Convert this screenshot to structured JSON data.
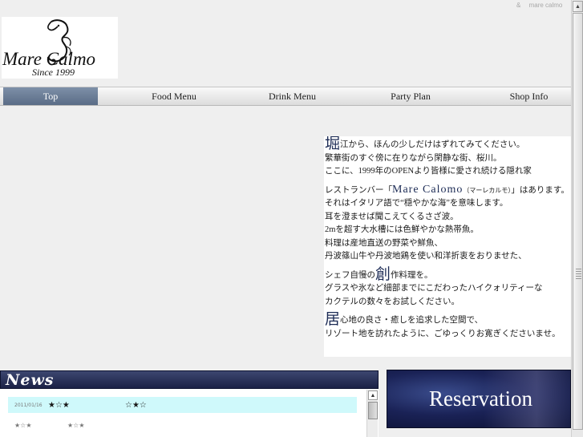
{
  "header": {
    "ampersand": "&",
    "site_name": "mare calmo"
  },
  "logo": {
    "name": "Mare Calmo",
    "since": "Since 1999"
  },
  "nav": {
    "items": [
      {
        "label": "Top"
      },
      {
        "label": "Food Menu"
      },
      {
        "label": "Drink Menu"
      },
      {
        "label": "Party Plan"
      },
      {
        "label": "Shop Info"
      }
    ]
  },
  "intro": {
    "p1_initial": "堀",
    "p1_line1": "江から、ほんの少しだけはずれてみてください。",
    "p1_line2": "繁華街のすぐ傍に在りながら閑静な街、桜川。",
    "p1_line3": "ここに、1999年のOPENより皆様に愛され続ける隠れ家",
    "p2_prefix": "レストランバー「",
    "p2_brand": "Mare Calomo",
    "p2_reading": "（マーレカルモ）",
    "p2_suffix": "」はあります。",
    "p2_line2": "それはイタリア語で“穏やかな海”を意味します。",
    "p2_line3": "耳を澄ませば聞こえてくるさざ波。",
    "p2_line4": "2mを超す大水槽には色鮮やかな熱帯魚。",
    "p2_line5": "料理は産地直送の野菜や鮮魚、",
    "p2_line6": "丹波篠山牛や丹波地鶏を使い和洋折衷をおりませた、",
    "p3_prefix": "シェフ自慢の",
    "p3_initial": "創",
    "p3_suffix": "作料理を。",
    "p3_line2": "グラスや氷など細部までにこだわったハイクォリティーな",
    "p3_line3": "カクテルの数々をお試しください。",
    "p4_initial": "居",
    "p4_line1": "心地の良さ・癒しを追求した空間で、",
    "p4_line2": "リゾート地を訪れたように、ごゆっくりお寛ぎくださいませ。"
  },
  "news": {
    "title": "News",
    "items": [
      {
        "date": "2011/01/16",
        "stars1": "★☆★",
        "stars2": "☆★☆"
      },
      {
        "date": "",
        "stars1": "★☆★",
        "stars2": "★☆★"
      }
    ]
  },
  "reservation": {
    "label": "Reservation"
  },
  "colors": {
    "nav_active": "#6a7c96",
    "news_header": "#2a3158",
    "news_highlight": "#cff9fb",
    "accent_text": "#1c2b55"
  }
}
